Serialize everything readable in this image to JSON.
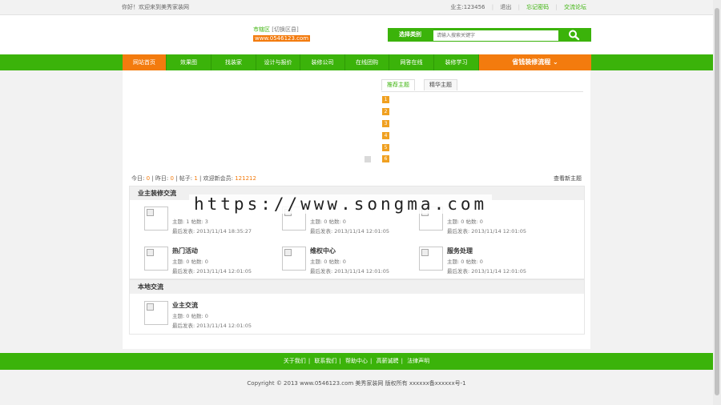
{
  "topbar": {
    "greeting": "你好！欢迎来到美秀家装网",
    "user": "业主:123456",
    "logout": "退出",
    "links": [
      "忘记密码",
      "交流论坛"
    ]
  },
  "header": {
    "city": "市辖区",
    "switch": "[切换区县]",
    "domain": "www.0546123.com",
    "search": {
      "select_label": "选择类别",
      "placeholder": "请输入搜索关键字",
      "button_icon": "search-icon"
    }
  },
  "nav": {
    "items": [
      "网站首页",
      "效果图",
      "找装家",
      "设计与报价",
      "装修公司",
      "在线团购",
      "网答在线",
      "装修学习"
    ],
    "cta": "省钱装修流程"
  },
  "tabs": [
    "推荐主题",
    "精华主题"
  ],
  "rank_numbers": [
    "1",
    "2",
    "3",
    "4",
    "5",
    "6"
  ],
  "stats": {
    "today_label": "今日:",
    "today": "0",
    "yesterday_label": "昨日:",
    "yesterday": "0",
    "posts_label": "帖子:",
    "posts": "1",
    "welcome_label": "欢迎新会员:",
    "new_member": "121212",
    "newest_link": "查看新主题"
  },
  "sections": [
    {
      "title": "业主装修交流",
      "forums": [
        {
          "name": "",
          "counts": "主题: 1 帖数: 3",
          "last": "最后发表:  2013/11/14 18:35:27"
        },
        {
          "name": "",
          "counts": "主题: 0 帖数: 0",
          "last": "最后发表:  2013/11/14 12:01:05"
        },
        {
          "name": "",
          "counts": "主题: 0 帖数: 0",
          "last": "最后发表:  2013/11/14 12:01:05"
        },
        {
          "name": "热门活动",
          "counts": "主题: 0 帖数: 0",
          "last": "最后发表:  2013/11/14 12:01:05"
        },
        {
          "name": "维权中心",
          "counts": "主题: 0 帖数: 0",
          "last": "最后发表:  2013/11/14 12:01:05"
        },
        {
          "name": "服务处理",
          "counts": "主题: 0 帖数: 0",
          "last": "最后发表:  2013/11/14 12:01:05"
        }
      ]
    },
    {
      "title": "本地交流",
      "forums": [
        {
          "name": "业主交流",
          "counts": "主题: 0 帖数: 0",
          "last": "最后发表:  2013/11/14 12:01:05"
        }
      ]
    }
  ],
  "watermark": "https://www.songma.com",
  "footer": {
    "links": [
      "关于我们",
      "联系我们",
      "帮助中心",
      "高薪诚聘",
      "法律声明"
    ],
    "copyright": "Copyright © 2013 www.0546123.com 美秀家装网 版权所有 xxxxxx备xxxxxx号-1"
  },
  "colors": {
    "brand_green": "#3bb30a",
    "accent_orange": "#f37b0e",
    "rank_orange": "#f0a020"
  }
}
